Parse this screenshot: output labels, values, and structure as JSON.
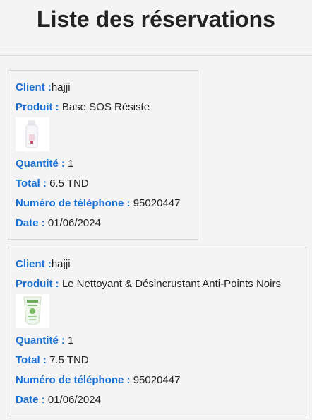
{
  "page": {
    "title": "Liste des réservations"
  },
  "colors": {
    "label": "#1a6fd3",
    "text": "#222222",
    "background": "#f4f4f4"
  },
  "reservations": [
    {
      "client_label": "Client :",
      "client": "hajji",
      "product_label": "Produit :",
      "product": "Base SOS Résiste",
      "product_icon": "white-bottle-image",
      "quantity_label": "Quantité :",
      "quantity": "1",
      "total_label": "Total :",
      "total": "6.5 TND",
      "phone_label": "Numéro de téléphone :",
      "phone": "95020447",
      "date_label": "Date :",
      "date": "01/06/2024"
    },
    {
      "client_label": "Client :",
      "client": "hajji",
      "product_label": "Produit :",
      "product": "Le Nettoyant & Désincrustant Anti-Points Noirs",
      "product_icon": "green-tube-image",
      "quantity_label": "Quantité :",
      "quantity": "1",
      "total_label": "Total :",
      "total": "7.5 TND",
      "phone_label": "Numéro de téléphone :",
      "phone": "95020447",
      "date_label": "Date :",
      "date": "01/06/2024"
    }
  ]
}
